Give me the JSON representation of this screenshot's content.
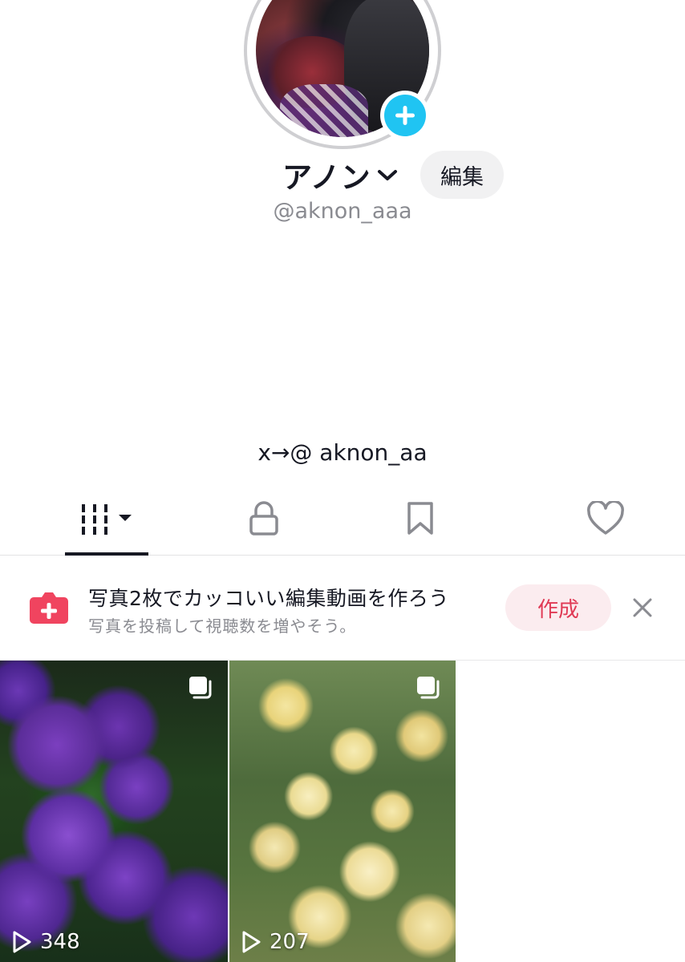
{
  "profile": {
    "display_name": "アノン",
    "username": "@aknon_aaa",
    "edit_label": "編集",
    "bio": "x→@ aknon_aa"
  },
  "tabs": [
    {
      "icon": "videos-grid-icon",
      "active": true
    },
    {
      "icon": "lock-icon",
      "active": false
    },
    {
      "icon": "bookmark-icon",
      "active": false
    },
    {
      "icon": "heart-icon",
      "active": false
    }
  ],
  "promo": {
    "title": "写真2枚でカッコいい編集動画を作ろう",
    "subtitle": "写真を投稿して視聴数を増やそう。",
    "create_label": "作成",
    "accent": "#e03a55"
  },
  "posts": [
    {
      "views": "348",
      "type": "photo-carousel"
    },
    {
      "views": "207",
      "type": "photo-carousel"
    }
  ],
  "colors": {
    "add_badge": "#20c4f2",
    "promo_icon": "#f0445f",
    "text_primary": "#161823",
    "text_secondary": "#8a8b91"
  }
}
